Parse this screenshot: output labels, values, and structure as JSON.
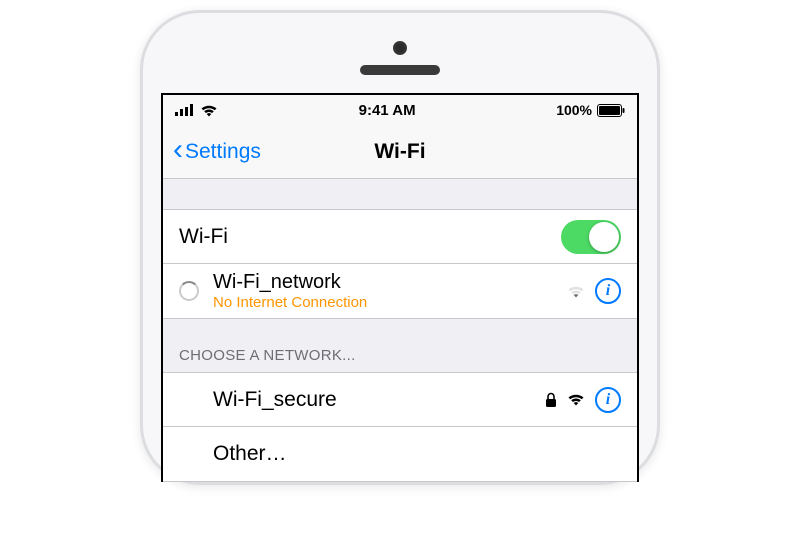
{
  "statusBar": {
    "time": "9:41 AM",
    "battery": "100%"
  },
  "nav": {
    "back": "Settings",
    "title": "Wi-Fi"
  },
  "wifiToggle": {
    "label": "Wi-Fi",
    "on": true
  },
  "currentNetwork": {
    "name": "Wi-Fi_network",
    "status": "No Internet Connection"
  },
  "sectionHeader": "CHOOSE A NETWORK...",
  "networks": [
    {
      "name": "Wi-Fi_secure",
      "secured": true
    }
  ],
  "other": "Other…",
  "colors": {
    "tint": "#007aff",
    "warning": "#ff9500",
    "toggleOn": "#4cd964"
  }
}
